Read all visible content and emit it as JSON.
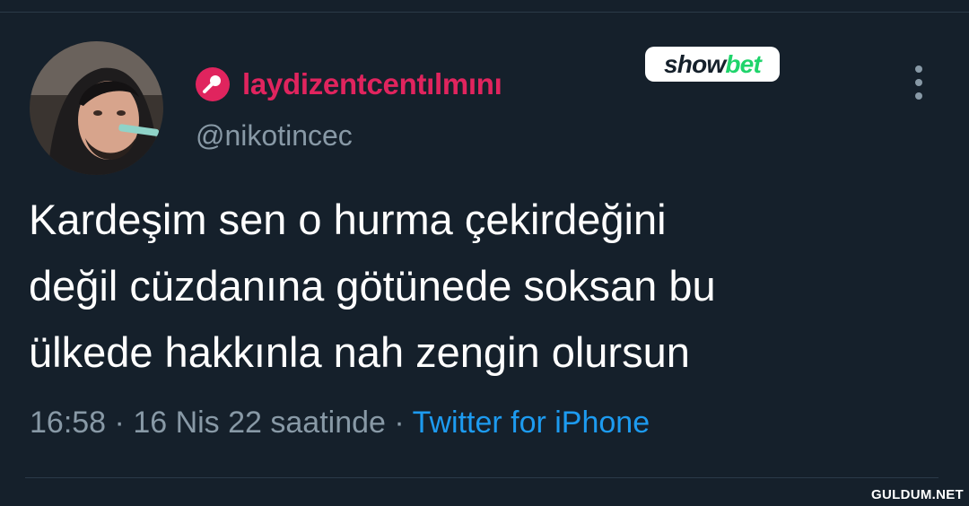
{
  "user": {
    "display_name": "laydizentcentılmını",
    "handle": "@nikotincec",
    "badge_icon": "microphone-icon",
    "badge_color": "#e0245e"
  },
  "watermark": {
    "part1": "show",
    "part2": "bet"
  },
  "tweet": {
    "lines": [
      "Kardeşim sen o hurma çekirdeğini",
      "değil cüzdanına götünede soksan bu",
      "ülkede hakkınla nah zengin olursun"
    ]
  },
  "meta": {
    "time": "16:58",
    "sep1": " · ",
    "date": "16 Nis 22 saatinde",
    "sep2": " · ",
    "source": "Twitter for iPhone"
  },
  "site_mark": "GULDUM.NET",
  "colors": {
    "background": "#15202b",
    "name": "#e0245e",
    "muted": "#8899a6",
    "link": "#1d9bf0",
    "text": "#ffffff"
  }
}
